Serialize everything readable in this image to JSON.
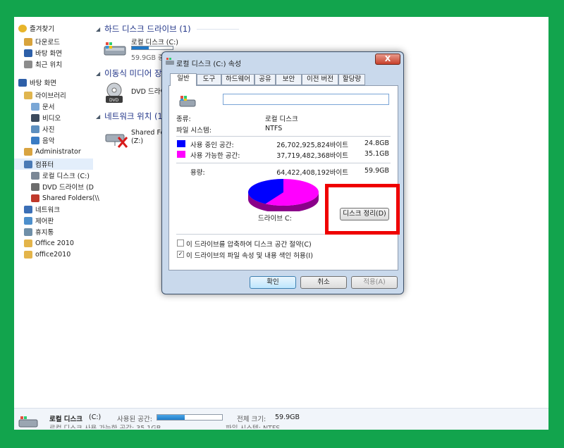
{
  "nav": {
    "items": [
      {
        "label": "즐겨찾기",
        "icon": "star-icon",
        "color": "#e8b52a",
        "indent": 0
      },
      {
        "label": "다운로드",
        "icon": "download-folder-icon",
        "color": "#d8a33c",
        "indent": 1
      },
      {
        "label": "바탕 화면",
        "icon": "desktop-icon",
        "color": "#2d5fa8",
        "indent": 1
      },
      {
        "label": "최근 위치",
        "icon": "recent-places-icon",
        "color": "#8c8c8c",
        "indent": 1
      },
      {
        "label": "바탕 화면",
        "icon": "desktop-icon",
        "color": "#2d5fa8",
        "indent": 0
      },
      {
        "label": "라이브러리",
        "icon": "library-icon",
        "color": "#e0b54e",
        "indent": 1
      },
      {
        "label": "문서",
        "icon": "documents-icon",
        "color": "#7aa7d6",
        "indent": 2
      },
      {
        "label": "비디오",
        "icon": "video-icon",
        "color": "#3c4a5c",
        "indent": 2
      },
      {
        "label": "사진",
        "icon": "pictures-icon",
        "color": "#5d8fbf",
        "indent": 2
      },
      {
        "label": "음악",
        "icon": "music-icon",
        "color": "#3a7cc4",
        "indent": 2
      },
      {
        "label": "Administrator",
        "icon": "user-folder-icon",
        "color": "#d9a441",
        "indent": 1
      },
      {
        "label": "컴퓨터",
        "icon": "computer-icon",
        "color": "#4a7ab5",
        "indent": 1,
        "selected": true
      },
      {
        "label": "로컬 디스크 (C:)",
        "icon": "local-disk-icon",
        "color": "#7b8795",
        "indent": 2
      },
      {
        "label": "DVD 드라이브 (D",
        "icon": "dvd-drive-icon",
        "color": "#6c6c6c",
        "indent": 2
      },
      {
        "label": "Shared Folders(\\\\",
        "icon": "network-drive-icon",
        "color": "#c0392b",
        "indent": 2
      },
      {
        "label": "네트워크",
        "icon": "network-icon",
        "color": "#3b6fb6",
        "indent": 1
      },
      {
        "label": "제어판",
        "icon": "control-panel-icon",
        "color": "#4d8fcc",
        "indent": 1
      },
      {
        "label": "휴지통",
        "icon": "recycle-bin-icon",
        "color": "#6f8fa8",
        "indent": 1
      },
      {
        "label": "Office 2010",
        "icon": "folder-icon",
        "color": "#e3b44a",
        "indent": 1
      },
      {
        "label": "office2010",
        "icon": "folder-icon",
        "color": "#e3b44a",
        "indent": 1
      }
    ]
  },
  "content": {
    "hdd_group": "하드 디스크 드라이브 (1)",
    "removable_group": "이동식 미디어 장",
    "network_group": "네트워크 위치 (1",
    "local_disk_name": "로컬 디스크 (C:)",
    "local_disk_free": "59.9GB 중",
    "local_disk_usage": 0.42,
    "dvd_name": "DVD 드라이",
    "shared_name": "Shared Fold",
    "shared_sub": "(Z:)"
  },
  "status": {
    "drive_name": "로컬 디스크",
    "drive_letter": "(C:)",
    "used_label": "사용된 공간:",
    "total_label": "전체 크기:",
    "total_value": "59.9GB",
    "free_partial": "로컬 디스크      사용 가능한 공간: 35.1GB",
    "fs_partial": "파일 시스템: NTFS",
    "used_fraction": 0.42
  },
  "dialog": {
    "title": "로컬 디스크 (C:) 속성",
    "close": "X",
    "tabs": [
      "일반",
      "도구",
      "하드웨어",
      "공유",
      "보안",
      "이전 버전",
      "할당량"
    ],
    "name_value": "",
    "type_label": "종류:",
    "type_value": "로컬 디스크",
    "fs_label": "파일 시스템:",
    "fs_value": "NTFS",
    "used_label": "사용 중인 공간:",
    "used_bytes": "26,702,925,824바이트",
    "used_gb": "24.8GB",
    "free_label": "사용 가능한 공간:",
    "free_bytes": "37,719,482,368바이트",
    "free_gb": "35.1GB",
    "capacity_label": "용량:",
    "capacity_bytes": "64,422,408,192바이트",
    "capacity_gb": "59.9GB",
    "drive_caption": "드라이브 C:",
    "cleanup_button": "디스크 정리(D)",
    "compress_label": "이 드라이브를 압축하여 디스크 공간 절약(C)",
    "index_label": "이 드라이브의 파일 속성 및 내용 색인 허용(I)",
    "compress_checked": false,
    "index_checked": true,
    "ok": "확인",
    "cancel": "취소",
    "apply": "적용(A)",
    "used_color": "#0000ff",
    "free_color": "#ff00ff",
    "used_fraction": 0.415
  },
  "highlight_color": "#ef0000"
}
